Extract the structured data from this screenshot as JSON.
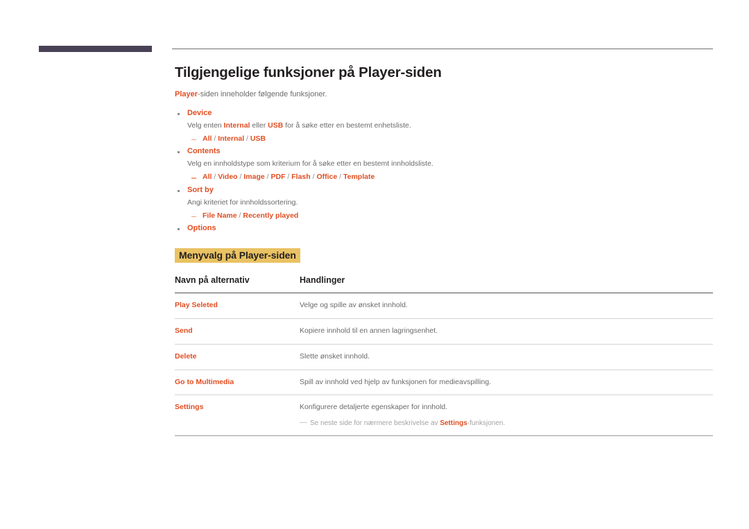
{
  "document": {
    "title": "Tilgjengelige funksjoner på Player-siden",
    "intro": {
      "accent": "Player",
      "rest": "-siden inneholder følgende funksjoner."
    },
    "bullets": [
      {
        "title": "Device",
        "desc_parts": [
          {
            "text": "Velg enten ",
            "style": "plain"
          },
          {
            "text": "Internal",
            "style": "accent"
          },
          {
            "text": " eller ",
            "style": "plain"
          },
          {
            "text": "USB",
            "style": "accent"
          },
          {
            "text": " for å søke etter en bestemt enhetsliste.",
            "style": "plain"
          }
        ],
        "options": "All / Internal / USB"
      },
      {
        "title": "Contents",
        "desc_parts": [
          {
            "text": "Velg en innholdstype som kriterium for å søke etter en bestemt innholdsliste.",
            "style": "plain"
          }
        ],
        "options": "All / Video / Image / PDF / Flash / Office / Template"
      },
      {
        "title": "Sort by",
        "desc_parts": [
          {
            "text": "Angi kriteriet for innholdssortering.",
            "style": "plain"
          }
        ],
        "options": "File Name / Recently played"
      },
      {
        "title": "Options",
        "desc_parts": [],
        "options": null
      }
    ],
    "sub_heading": "Menyvalg på Player-siden",
    "table": {
      "headers": [
        "Navn på alternativ",
        "Handlinger"
      ],
      "rows": [
        {
          "name": "Play Seleted",
          "desc": "Velge og spille av ønsket innhold."
        },
        {
          "name": "Send",
          "desc": "Kopiere innhold til en annen lagringsenhet."
        },
        {
          "name": "Delete",
          "desc": "Slette ønsket innhold."
        },
        {
          "name": "Go to Multimedia",
          "desc": "Spill av innhold ved hjelp av funksjonen for medieavspilling."
        },
        {
          "name": "Settings",
          "desc": "Konfigurere detaljerte egenskaper for innhold.",
          "note_parts": [
            {
              "text": "Se neste side for nærmere beskrivelse av ",
              "style": "plain"
            },
            {
              "text": "Settings",
              "style": "accent"
            },
            {
              "text": "-funksjonen.",
              "style": "plain"
            }
          ]
        }
      ]
    }
  },
  "colors": {
    "accent": "#e04e22",
    "accent_light": "#f0a184",
    "highlight": "#e9c263",
    "header_bar": "#494256",
    "body_text": "#6a6a6a",
    "heading_text": "#231f20",
    "rule": "#6f6f6f",
    "row_divider": "#d4d4d4",
    "note_text": "#a3a3a3"
  }
}
